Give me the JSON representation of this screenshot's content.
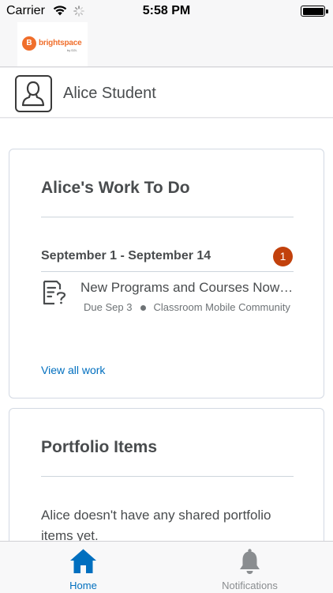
{
  "status_bar": {
    "carrier": "Carrier",
    "time": "5:58 PM"
  },
  "brand": {
    "logo_text": "brightspace",
    "logo_sub": "by D2L",
    "brand_color": "#f06e2b"
  },
  "user": {
    "name": "Alice Student"
  },
  "work_to_do": {
    "title": "Alice's Work To Do",
    "date_range": "September 1 - September 14",
    "count": "1",
    "badge_color": "#c2410c",
    "activities": [
      {
        "title": "New Programs and Courses Now Available",
        "due": "Due Sep 3",
        "course": "Classroom Mobile Community"
      }
    ],
    "view_all_label": "View all work"
  },
  "portfolio": {
    "title": "Portfolio Items",
    "empty_message": "Alice doesn't have any shared portfolio items yet."
  },
  "tab_bar": {
    "accent_color": "#006fbf",
    "tabs": [
      {
        "label": "Home",
        "icon": "home-icon",
        "active": true
      },
      {
        "label": "Notifications",
        "icon": "bell-icon",
        "active": false
      }
    ]
  }
}
